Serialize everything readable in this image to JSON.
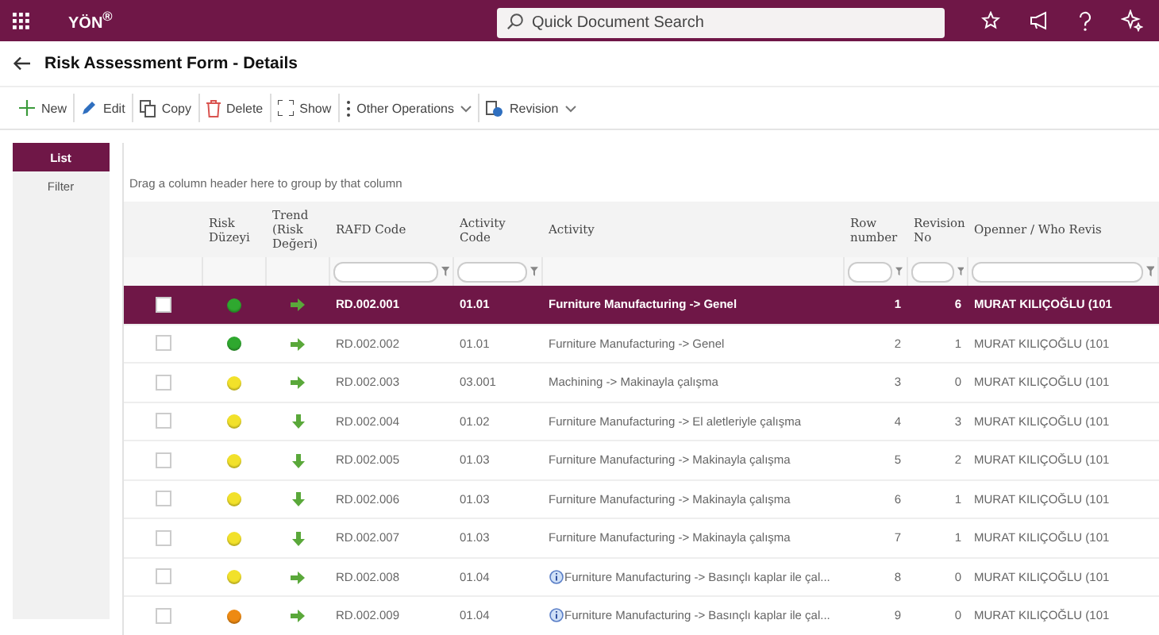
{
  "topbar": {
    "logo": "YÖN$^{®}$",
    "search": {
      "placeholder": "Quick Document Search"
    }
  },
  "page": {
    "title": "Risk Assessment Form - Details"
  },
  "toolbar": [
    {
      "kind": "new",
      "label": "New",
      "dropdown": false
    },
    {
      "kind": "edit",
      "label": "Edit",
      "dropdown": false
    },
    {
      "kind": "copy",
      "label": "Copy",
      "dropdown": false
    },
    {
      "kind": "delete",
      "label": "Delete",
      "dropdown": false
    },
    {
      "kind": "show",
      "label": "Show",
      "dropdown": false
    },
    {
      "kind": "more",
      "label": "Other Operations",
      "dropdown": true
    },
    {
      "kind": "revision",
      "label": "Revision",
      "dropdown": true
    }
  ],
  "side_tabs": [
    {
      "label": "List",
      "selected": true
    },
    {
      "label": "Filter",
      "selected": false
    }
  ],
  "grid": {
    "group_hint": "Drag a column header here to group by that column",
    "columns": [
      {
        "filter": false
      },
      {
        "label": "Risk Düzeyi",
        "filter": false
      },
      {
        "label": "Trend (Risk Değeri)",
        "filter": false
      },
      {
        "label": "RAFD Code",
        "filter": true
      },
      {
        "label": "Activity Code",
        "filter": true
      },
      {
        "label": "Activity",
        "filter": false
      },
      {
        "label": "Row number",
        "filter": true
      },
      {
        "label": "Revision No",
        "filter": true
      },
      {
        "label": "Openner / Who Revis",
        "filter": true
      }
    ],
    "rows": [
      {
        "selected": true,
        "checked": false,
        "color": "#2fa82f",
        "trend_down": false,
        "code": "RD.002.001",
        "activity_code": "01.01",
        "info": false,
        "activity": "Furniture Manufacturing -> Genel",
        "row_number": "1",
        "revision": "6",
        "opener": "MURAT KILIÇOĞLU (101"
      },
      {
        "selected": false,
        "checked": false,
        "color": "#2fa82f",
        "trend_down": false,
        "code": "RD.002.002",
        "activity_code": "01.01",
        "info": false,
        "activity": "Furniture Manufacturing -> Genel",
        "row_number": "2",
        "revision": "1",
        "opener": "MURAT KILIÇOĞLU (101"
      },
      {
        "selected": false,
        "checked": false,
        "color": "#f2e12a",
        "trend_down": false,
        "code": "RD.002.003",
        "activity_code": "03.001",
        "info": false,
        "activity": "Machining -> Makinayla çalışma",
        "row_number": "3",
        "revision": "0",
        "opener": "MURAT KILIÇOĞLU (101"
      },
      {
        "selected": false,
        "checked": false,
        "color": "#f2e12a",
        "trend_down": true,
        "code": "RD.002.004",
        "activity_code": "01.02",
        "info": false,
        "activity": "Furniture Manufacturing -> El aletleriyle çalışma",
        "row_number": "4",
        "revision": "3",
        "opener": "MURAT KILIÇOĞLU (101"
      },
      {
        "selected": false,
        "checked": false,
        "color": "#f2e12a",
        "trend_down": true,
        "code": "RD.002.005",
        "activity_code": "01.03",
        "info": false,
        "activity": "Furniture Manufacturing -> Makinayla çalışma",
        "row_number": "5",
        "revision": "2",
        "opener": "MURAT KILIÇOĞLU (101"
      },
      {
        "selected": false,
        "checked": false,
        "color": "#f2e12a",
        "trend_down": true,
        "code": "RD.002.006",
        "activity_code": "01.03",
        "info": false,
        "activity": "Furniture Manufacturing -> Makinayla çalışma",
        "row_number": "6",
        "revision": "1",
        "opener": "MURAT KILIÇOĞLU (101"
      },
      {
        "selected": false,
        "checked": false,
        "color": "#f2e12a",
        "trend_down": true,
        "code": "RD.002.007",
        "activity_code": "01.03",
        "info": false,
        "activity": "Furniture Manufacturing -> Makinayla çalışma",
        "row_number": "7",
        "revision": "1",
        "opener": "MURAT KILIÇOĞLU (101"
      },
      {
        "selected": false,
        "checked": false,
        "color": "#f2e12a",
        "trend_down": false,
        "code": "RD.002.008",
        "activity_code": "01.04",
        "info": true,
        "activity": "Furniture Manufacturing -> Basınçlı kaplar ile çal...",
        "row_number": "8",
        "revision": "0",
        "opener": "MURAT KILIÇOĞLU (101"
      },
      {
        "selected": false,
        "checked": false,
        "color": "#ee8a12",
        "trend_down": false,
        "code": "RD.002.009",
        "activity_code": "01.04",
        "info": true,
        "activity": "Furniture Manufacturing -> Basınçlı kaplar ile çal...",
        "row_number": "9",
        "revision": "0",
        "opener": "MURAT KILIÇOĞLU (101"
      }
    ]
  }
}
